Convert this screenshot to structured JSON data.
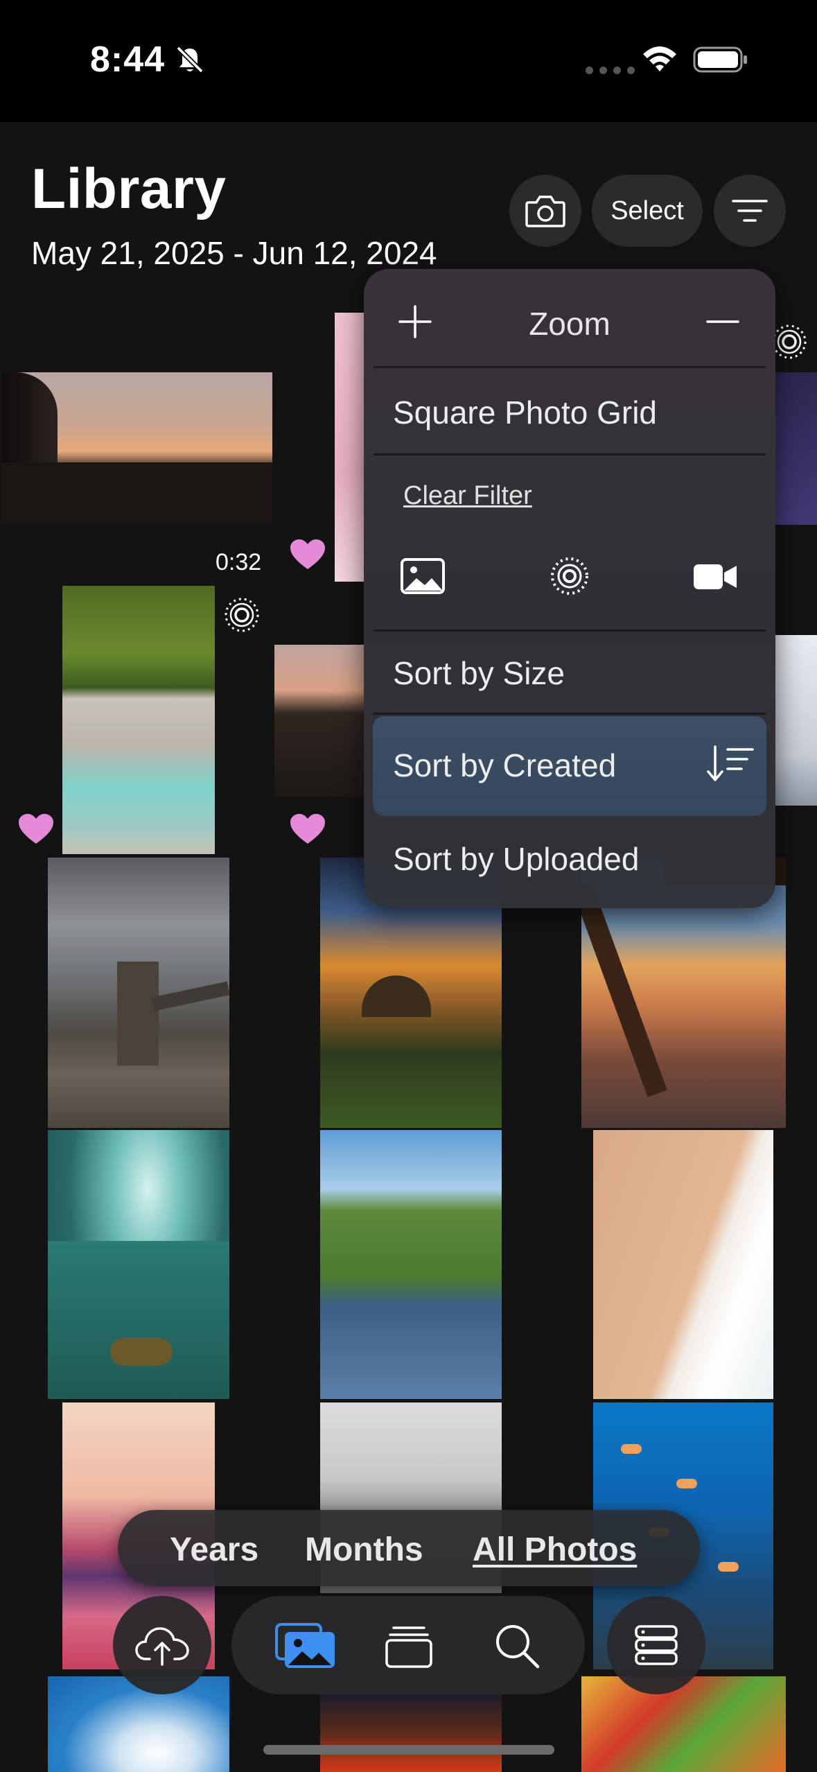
{
  "status_bar": {
    "time": "8:44"
  },
  "header": {
    "title": "Library",
    "date_range": "May 21, 2025 - Jun 12, 2024",
    "select_label": "Select"
  },
  "photos": {
    "video_duration": "0:32"
  },
  "menu": {
    "zoom_label": "Zoom",
    "square_grid": "Square Photo Grid",
    "clear_filter": "Clear Filter",
    "sort_size": "Sort by Size",
    "sort_created": "Sort by Created",
    "sort_uploaded": "Sort by Uploaded"
  },
  "segments": {
    "years": "Years",
    "months": "Months",
    "all_photos": "All Photos",
    "selected": "All Photos"
  },
  "colors": {
    "accent": "#3d8ff0",
    "heart": "#e58ad8",
    "menu_selected": "#3d4f66"
  }
}
